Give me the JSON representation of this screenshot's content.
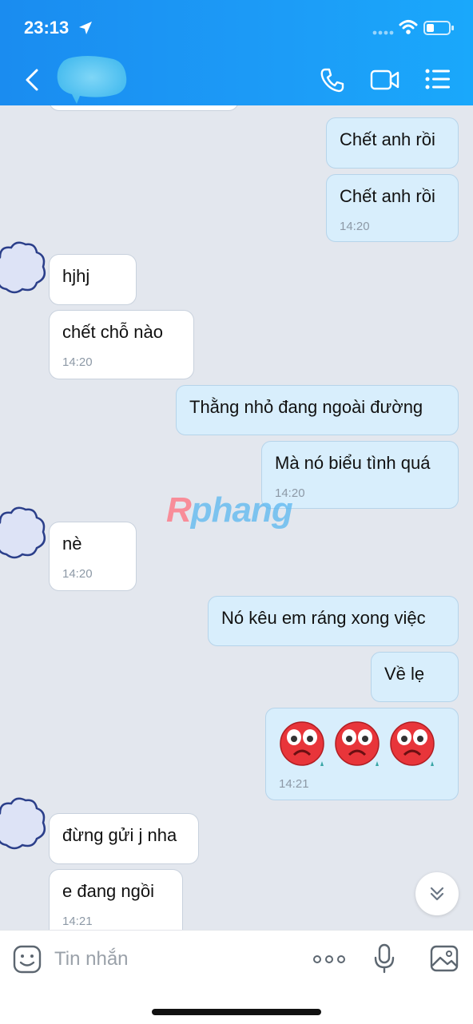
{
  "status_bar": {
    "time": "23:13"
  },
  "messages": [
    {
      "side": "out",
      "text": "Chết anh rồi",
      "time": ""
    },
    {
      "side": "out",
      "text": "Chết anh rồi",
      "time": "14:20"
    },
    {
      "side": "in",
      "text": "hjhj",
      "time": ""
    },
    {
      "side": "in",
      "text": "chết chỗ nào",
      "time": "14:20"
    },
    {
      "side": "out",
      "text": "Thằng nhỏ đang ngoài đường",
      "time": ""
    },
    {
      "side": "out",
      "text": "Mà nó biểu tình quá",
      "time": "14:20"
    },
    {
      "side": "in",
      "text": "nè",
      "time": "14:20"
    },
    {
      "side": "out",
      "text": "Nó kêu em ráng xong việc",
      "time": ""
    },
    {
      "side": "out",
      "text": "Về lẹ",
      "time": ""
    },
    {
      "side": "out",
      "text": "",
      "time": "14:21",
      "emoji": [
        "crying-face",
        "crying-face",
        "crying-face"
      ]
    },
    {
      "side": "in",
      "text": "đừng gửi j nha",
      "time": ""
    },
    {
      "side": "in",
      "text": "e đang ngồi",
      "time": "14:21"
    }
  ],
  "watermark": {
    "part1": "R",
    "part2": "phang"
  },
  "composer": {
    "placeholder": "Tin nhắn"
  },
  "colors": {
    "header": "#1a8cf0",
    "outgoing_bubble": "#d8eefc",
    "incoming_bubble": "#ffffff",
    "background": "#e3e7ee"
  }
}
